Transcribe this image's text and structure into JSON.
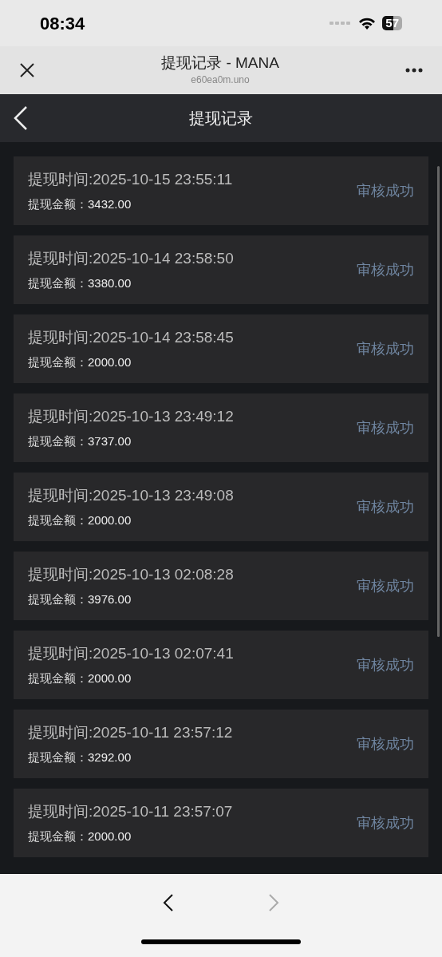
{
  "status_bar": {
    "time": "08:34",
    "battery": "57"
  },
  "browser_bar": {
    "title": "提现记录 - MANA",
    "url": "e60ea0m.uno"
  },
  "app_header": {
    "title": "提现记录"
  },
  "records": [
    {
      "time": "提现时间:2025-10-15 23:55:11",
      "amount_label": "提现金额：",
      "amount": "3432.00",
      "status": "审核成功"
    },
    {
      "time": "提现时间:2025-10-14 23:58:50",
      "amount_label": "提现金额：",
      "amount": "3380.00",
      "status": "审核成功"
    },
    {
      "time": "提现时间:2025-10-14 23:58:45",
      "amount_label": "提现金额：",
      "amount": "2000.00",
      "status": "审核成功"
    },
    {
      "time": "提现时间:2025-10-13 23:49:12",
      "amount_label": "提现金额：",
      "amount": "3737.00",
      "status": "审核成功"
    },
    {
      "time": "提现时间:2025-10-13 23:49:08",
      "amount_label": "提现金额：",
      "amount": "2000.00",
      "status": "审核成功"
    },
    {
      "time": "提现时间:2025-10-13 02:08:28",
      "amount_label": "提现金额：",
      "amount": "3976.00",
      "status": "审核成功"
    },
    {
      "time": "提现时间:2025-10-13 02:07:41",
      "amount_label": "提现金额：",
      "amount": "2000.00",
      "status": "审核成功"
    },
    {
      "time": "提现时间:2025-10-11 23:57:12",
      "amount_label": "提现金额：",
      "amount": "3292.00",
      "status": "审核成功"
    },
    {
      "time": "提现时间:2025-10-11 23:57:07",
      "amount_label": "提现金额：",
      "amount": "2000.00",
      "status": "审核成功"
    }
  ],
  "bottom_nav": {
    "back": {
      "disabled": false
    },
    "forward": {
      "disabled": true
    }
  }
}
